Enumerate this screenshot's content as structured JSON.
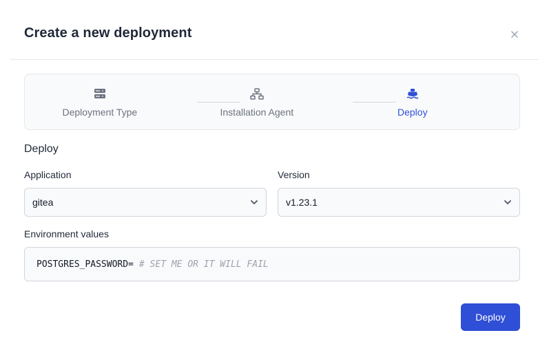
{
  "dialog": {
    "title": "Create a new deployment",
    "close_icon": "close-icon"
  },
  "stepper": {
    "steps": [
      {
        "label": "Deployment Type",
        "icon": "server-icon",
        "active": false
      },
      {
        "label": "Installation Agent",
        "icon": "network-icon",
        "active": false
      },
      {
        "label": "Deploy",
        "icon": "ship-icon",
        "active": true
      }
    ],
    "colors": {
      "active": "#2f4fd6",
      "inactive": "#6b7280"
    }
  },
  "form": {
    "section_title": "Deploy",
    "application": {
      "label": "Application",
      "value": "gitea"
    },
    "version": {
      "label": "Version",
      "value": "v1.23.1"
    },
    "environment": {
      "label": "Environment values",
      "key": "POSTGRES_PASSWORD=",
      "comment": "# SET ME OR IT WILL FAIL"
    }
  },
  "actions": {
    "deploy_label": "Deploy",
    "accent_color": "#2f4fd6"
  }
}
